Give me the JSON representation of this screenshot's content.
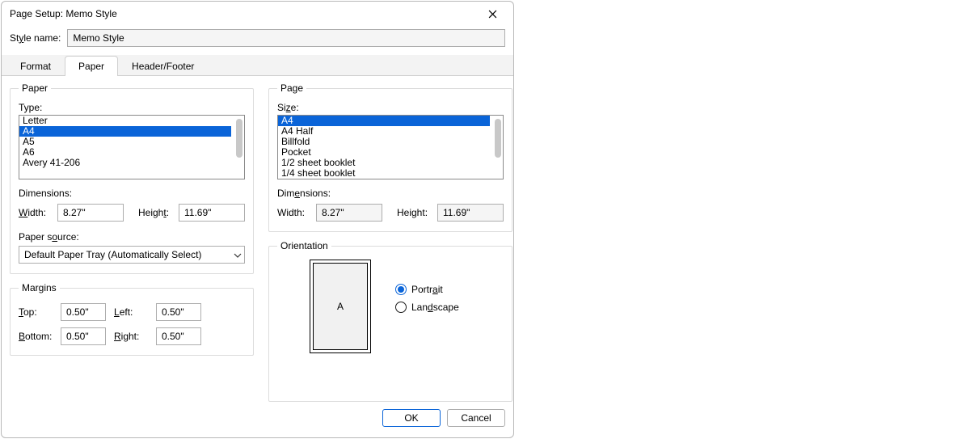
{
  "window": {
    "title": "Page Setup: Memo Style"
  },
  "style_row": {
    "label_html": "St<span class=\"u\">y</span>le name:",
    "value": "Memo Style"
  },
  "tabs": {
    "format": "Format",
    "paper": "Paper",
    "headerfooter": "Header/Footer",
    "active": "paper"
  },
  "left": {
    "paper": {
      "legend": "Paper",
      "type_label": "Type:",
      "type_items": [
        "Letter",
        "A4",
        "A5",
        "A6",
        "",
        "Avery 41-206"
      ],
      "type_selected_index": 1,
      "dimensions_label": "Dimensions:",
      "width_label_html": "<span class=\"u\">W</span>idth:",
      "width_value": "8.27\"",
      "height_label_html": "Heigh<span class=\"u\">t</span>:",
      "height_value": "11.69\"",
      "source_label_html": "Paper s<span class=\"u\">o</span>urce:",
      "source_value": "Default Paper Tray (Automatically Select)"
    },
    "margins": {
      "legend": "Margins",
      "top_label_html": "<span class=\"u\">T</span>op:",
      "top_value": "0.50\"",
      "left_label_html": "<span class=\"u\">L</span>eft:",
      "left_value": "0.50\"",
      "bottom_label_html": "<span class=\"u\">B</span>ottom:",
      "bottom_value": "0.50\"",
      "right_label_html": "<span class=\"u\">R</span>ight:",
      "right_value": "0.50\""
    }
  },
  "right": {
    "page": {
      "legend": "Page",
      "size_label_html": "Si<span class=\"u\">z</span>e:",
      "size_items": [
        "A4",
        "A4 Half",
        "Billfold",
        "Pocket",
        "1/2 sheet booklet",
        "1/4 sheet booklet"
      ],
      "size_selected_index": 0,
      "dimensions_label_html": "Dim<span class=\"u\">e</span>nsions:",
      "width_label": "Width:",
      "width_value": "8.27\"",
      "height_label": "Height:",
      "height_value": "11.69\""
    },
    "orientation": {
      "legend": "Orientation",
      "preview_letter": "A",
      "portrait_label_html": "Portr<span class=\"u\">a</span>it",
      "landscape_label_html": "Lan<span class=\"u\">d</span>scape",
      "value": "portrait"
    }
  },
  "footer": {
    "ok": "OK",
    "cancel": "Cancel"
  }
}
